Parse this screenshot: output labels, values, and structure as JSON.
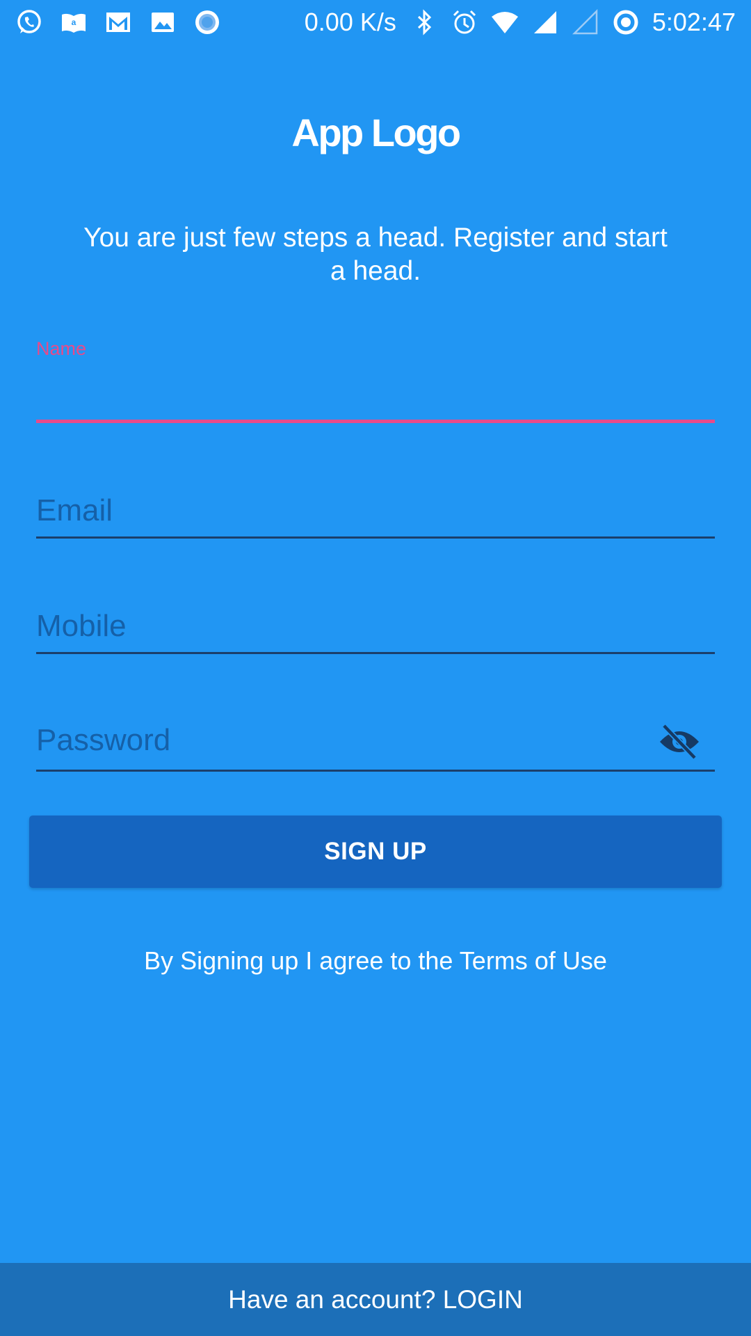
{
  "status_bar": {
    "left_icons": [
      "whatsapp-icon",
      "amazon-kindle-icon",
      "gmail-icon",
      "gallery-icon",
      "record-icon"
    ],
    "net_speed": "0.00 K/s",
    "right_icons": [
      "bluetooth-icon",
      "alarm-icon",
      "wifi-icon",
      "signal-full-icon",
      "signal-empty-icon",
      "data-saver-icon"
    ],
    "time": "5:02:47"
  },
  "header": {
    "logo_text": "App Logo",
    "tagline": "You are just few steps a head. Register and start a head."
  },
  "form": {
    "name": {
      "label": "Name",
      "value": "",
      "active": true
    },
    "email": {
      "placeholder": "Email",
      "value": ""
    },
    "mobile": {
      "placeholder": "Mobile",
      "value": ""
    },
    "password": {
      "placeholder": "Password",
      "value": "",
      "visibility_icon": "visibility-off-icon"
    }
  },
  "actions": {
    "signup_label": "SIGN UP",
    "terms_text": "By Signing up I agree to the Terms of Use"
  },
  "footer": {
    "login_prompt": "Have an account? LOGIN"
  },
  "colors": {
    "background": "#2196F3",
    "button": "#1565C0",
    "footer": "#1C6FB8",
    "accent": "#E84A8A",
    "underline": "#1B3F6B",
    "placeholder": "#1560A8"
  }
}
